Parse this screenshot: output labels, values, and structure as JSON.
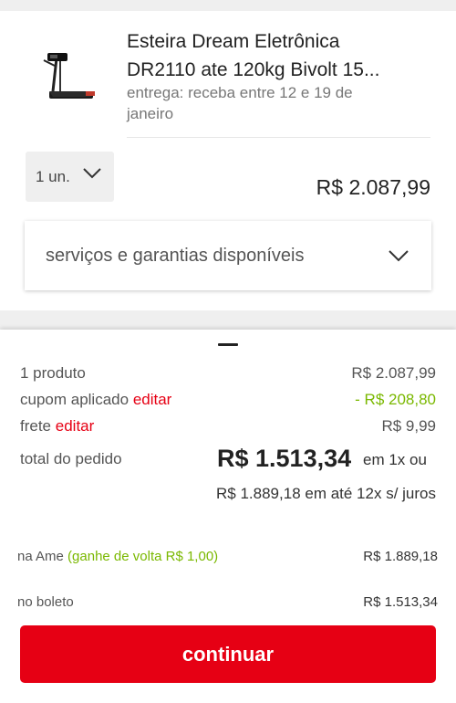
{
  "product": {
    "title_line1": "Esteira Dream Eletrônica",
    "title_line2": "DR2110 ate 120kg Bivolt 15...",
    "delivery_line1": "entrega: receba entre 12 e 19 de",
    "delivery_line2": "janeiro",
    "quantity": "1 un.",
    "price": "R$ 2.087,99",
    "image_icon": "treadmill-icon"
  },
  "services": {
    "label": "serviços e garantias disponíveis"
  },
  "summary": {
    "products_label": "1 produto",
    "products_value": "R$ 2.087,99",
    "coupon_label": "cupom aplicado",
    "coupon_edit": "editar",
    "coupon_value": "- R$ 208,80",
    "shipping_label": "frete",
    "shipping_edit": "editar",
    "shipping_value": "R$ 9,99",
    "total_label": "total do pedido",
    "total_amount": "R$ 1.513,34",
    "total_suffix": "em 1x ou",
    "installments": "R$ 1.889,18 em até 12x s/ juros"
  },
  "payment_options": [
    {
      "label": "na Ame",
      "promo": "(ganhe de volta R$ 1,00)",
      "value": "R$ 1.889,18"
    },
    {
      "label": "no boleto",
      "promo": "",
      "value": "R$ 1.513,34"
    }
  ],
  "actions": {
    "continue_label": "continuar"
  },
  "colors": {
    "brand_red": "#e60014",
    "promo_green": "#7ab800"
  }
}
